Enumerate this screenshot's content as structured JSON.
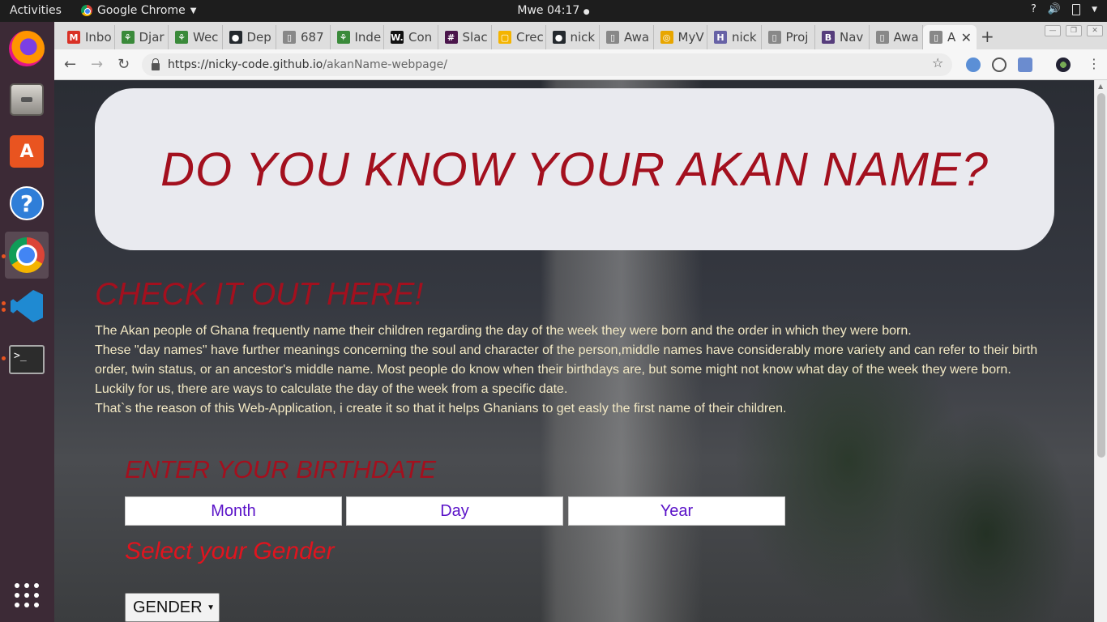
{
  "system": {
    "activities": "Activities",
    "app_name": "Google Chrome",
    "clock": "Mwe 04:17",
    "tray_help": "?"
  },
  "tabs": [
    {
      "label": "Inbo",
      "favicon": "gmail-icon",
      "color": "#d93025",
      "glyph": "M"
    },
    {
      "label": "Djar",
      "favicon": "palm-icon",
      "color": "#3a8a3a",
      "glyph": "⚘"
    },
    {
      "label": "Wec",
      "favicon": "palm-icon",
      "color": "#3a8a3a",
      "glyph": "⚘"
    },
    {
      "label": "Dep",
      "favicon": "github-icon",
      "color": "#24292e",
      "glyph": "●"
    },
    {
      "label": "687",
      "favicon": "page-icon",
      "color": "#888888",
      "glyph": "▯"
    },
    {
      "label": "Inde",
      "favicon": "palm-icon",
      "color": "#3a8a3a",
      "glyph": "⚘"
    },
    {
      "label": "Con",
      "favicon": "w-icon",
      "color": "#111111",
      "glyph": "W."
    },
    {
      "label": "Slac",
      "favicon": "slack-icon",
      "color": "#4a154b",
      "glyph": "#"
    },
    {
      "label": "Crec",
      "favicon": "slides-icon",
      "color": "#f4b400",
      "glyph": "▢"
    },
    {
      "label": "nick",
      "favicon": "github-icon",
      "color": "#24292e",
      "glyph": "●"
    },
    {
      "label": "Awa",
      "favicon": "page-icon",
      "color": "#888888",
      "glyph": "▯"
    },
    {
      "label": "MyV",
      "favicon": "myv-icon",
      "color": "#e8a600",
      "glyph": "◎"
    },
    {
      "label": "nick",
      "favicon": "heroku-icon",
      "color": "#6762a6",
      "glyph": "H"
    },
    {
      "label": "Proj",
      "favicon": "page-icon",
      "color": "#888888",
      "glyph": "▯"
    },
    {
      "label": "Nav",
      "favicon": "bootstrap-icon",
      "color": "#563d7c",
      "glyph": "B"
    },
    {
      "label": "Awa",
      "favicon": "page-icon",
      "color": "#888888",
      "glyph": "▯"
    },
    {
      "label": "A",
      "favicon": "page-icon",
      "color": "#888888",
      "glyph": "▯",
      "active": true
    }
  ],
  "browser": {
    "url_host": "https://nicky-code.github.io",
    "url_path": "/akanName-webpage/",
    "new_tab": "+",
    "close_tab": "✕"
  },
  "page": {
    "hero_title": "DO YOU KNOW YOUR AKAN NAME?",
    "check_title": "CHECK IT OUT HERE!",
    "intro_lines": [
      "The Akan people of Ghana frequently name their children regarding the day of the week they were born and the order in which they were born.",
      "These \"day names\" have further meanings concerning the soul and character of the person,middle names have considerably more variety and can refer to their birth order, twin status, or an ancestor's middle name. Most people do know when their birthdays are, but some might not know what day of the week they were born.",
      "Luckily for us, there are ways to calculate the day of the week from a specific date.",
      "That`s the reason of this Web-Application, i create it so that it helps Ghanians to get easly the first name of their children."
    ],
    "birthdate_title": "ENTER YOUR BIRTHDATE",
    "month_placeholder": "Month",
    "day_placeholder": "Day",
    "year_placeholder": "Year",
    "gender_title": "Select your Gender",
    "gender_selected": "GENDER"
  },
  "colors": {
    "heading_red": "#a3101e",
    "gender_red": "#e0141e",
    "intro_text": "#f3e9c4",
    "input_text": "#5a12c8",
    "hero_bg": "#e9eaef"
  }
}
